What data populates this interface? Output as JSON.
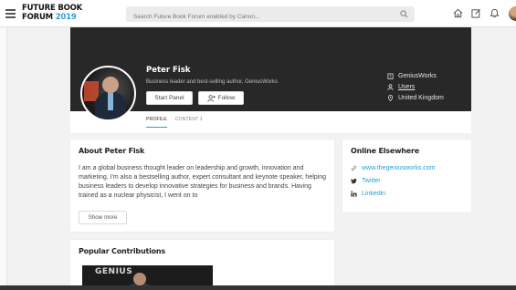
{
  "header": {
    "logo_line1": "FUTURE BOOK",
    "logo_line2_prefix": "FORUM ",
    "logo_year": "2019",
    "search_placeholder": "Search Future Book Forum enabled by Canon...",
    "icons": [
      "menu-icon",
      "search-icon",
      "home-icon",
      "compose-icon",
      "notification-icon",
      "avatar"
    ]
  },
  "profile": {
    "name": "Peter Fisk",
    "tagline": "Business leader and best-selling author, GeniusWorks",
    "start_panel_label": "Start Panel",
    "follow_label": "Follow",
    "company": "GeniusWorks",
    "role": "Users",
    "location": "United Kingdom",
    "tabs": [
      {
        "label": "PROFILE",
        "active": true
      },
      {
        "label": "CONTENT  1",
        "active": false
      }
    ]
  },
  "about": {
    "title": "About Peter Fisk",
    "text": "I am a global business thought leader on leadership and growth, innovation and marketing. I'm also a bestselling author, expert consultant and keynote speaker, helping business leaders to develop innovative strategies for business and brands. Having trained as a nuclear physicist, I went on to",
    "show_more_label": "Show more"
  },
  "online": {
    "title": "Online Elsewhere",
    "links": [
      {
        "icon": "link-icon",
        "label": "www.thegeniusworks.com"
      },
      {
        "icon": "twitter-icon",
        "label": "Twitter"
      },
      {
        "icon": "linkedin-icon",
        "label": "Linkedin"
      }
    ]
  },
  "contributions": {
    "title": "Popular Contributions",
    "image_text": "GENIUS"
  },
  "colors": {
    "accent": "#2a9fd6",
    "banner": "#282828",
    "background": "#f2f2f2"
  }
}
